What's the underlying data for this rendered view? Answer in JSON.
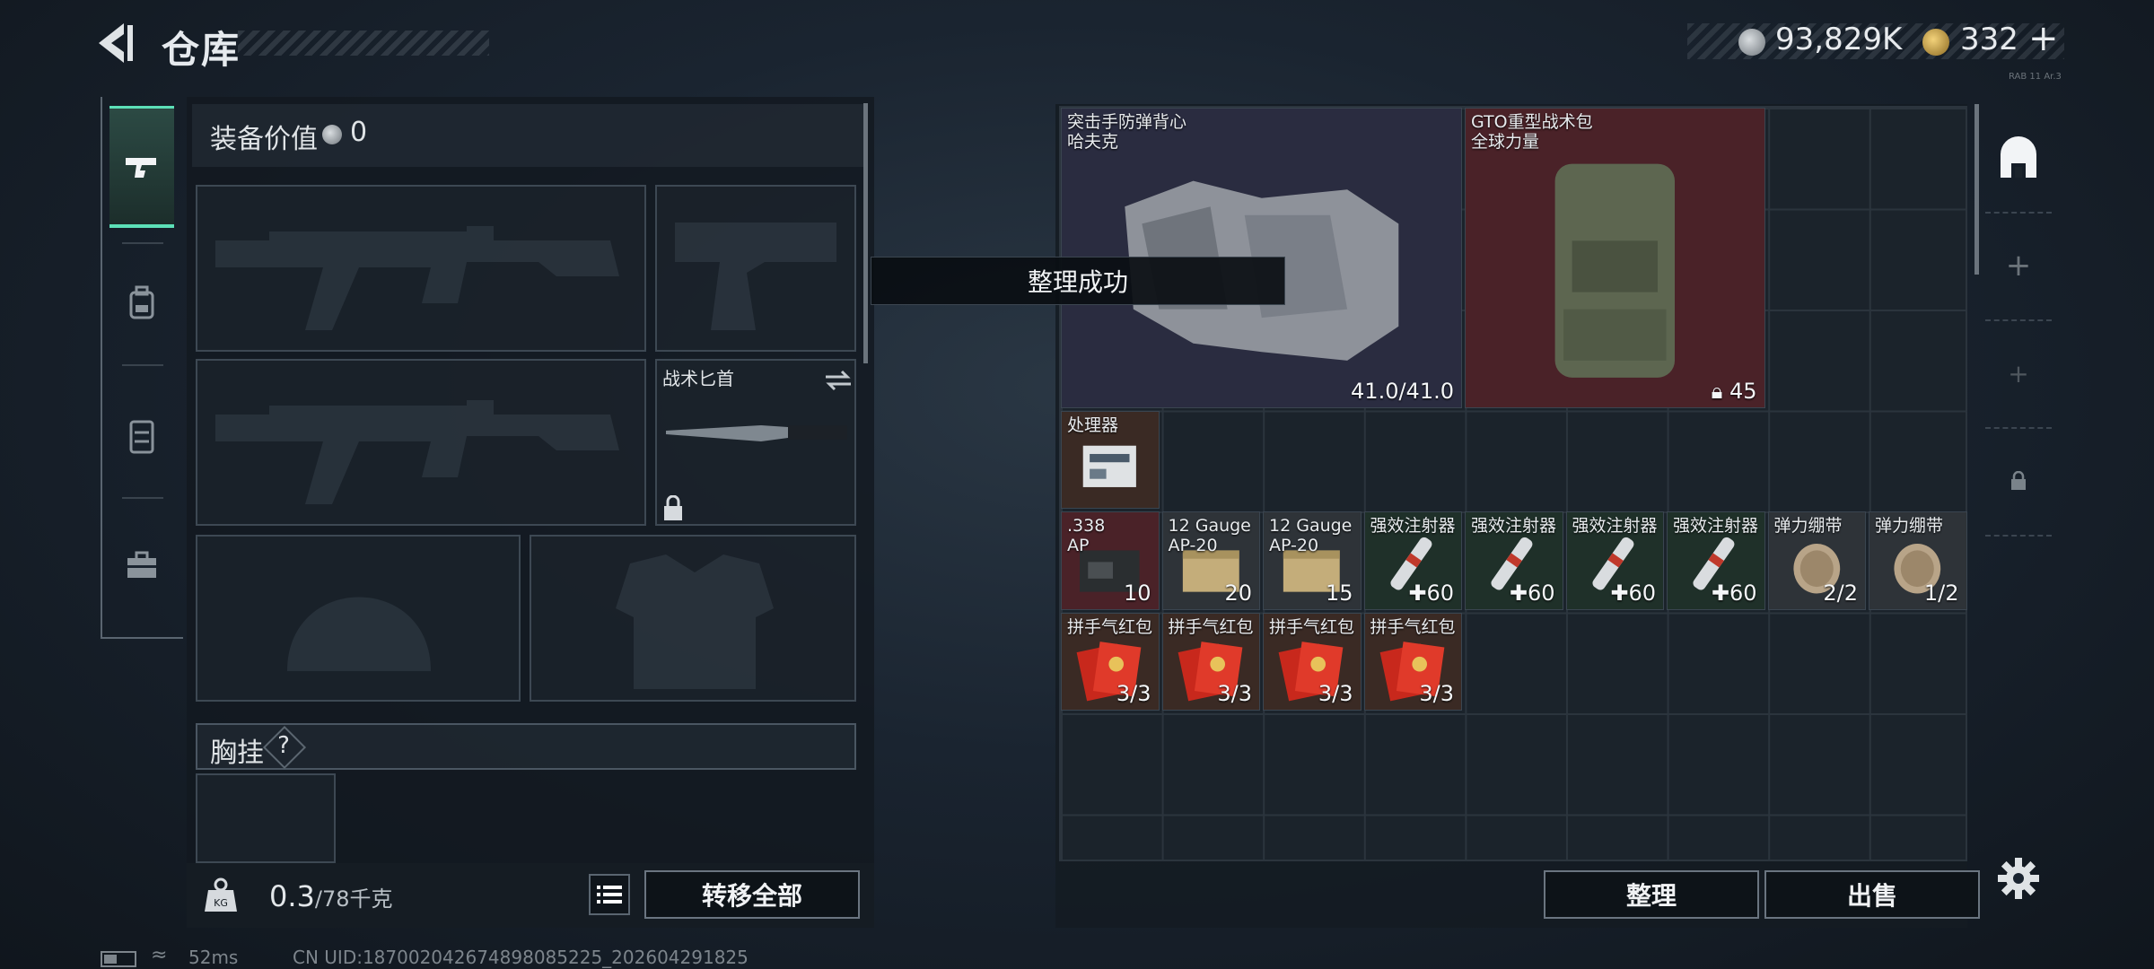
{
  "header": {
    "title": "仓库",
    "currency_silver": "93,829K",
    "currency_gold": "332",
    "add_label": "+",
    "tiny_tag": "RAB 11 Ar.3"
  },
  "sidebar": {
    "tabs": [
      {
        "icon": "pistol-icon",
        "active": true
      },
      {
        "icon": "backpack-icon",
        "active": false
      },
      {
        "icon": "vest-icon",
        "active": false
      },
      {
        "icon": "toolbox-icon",
        "active": false
      }
    ]
  },
  "equipment": {
    "value_label": "装备价值",
    "value": "0",
    "melee_label": "战术匕首",
    "chest_label": "胸挂",
    "chest_help": "?",
    "weight_value": "0.3",
    "weight_max": "/78千克",
    "transfer_all": "转移全部"
  },
  "toast": "整理成功",
  "inventory": {
    "items": [
      {
        "name": "突击手防弹背心\n哈夫克",
        "count": "41.0/41.0",
        "kind": "vest",
        "bg": "#2a2c40"
      },
      {
        "name": "GTO重型战术包\n全球力量",
        "count": "45",
        "kind": "backpack",
        "bg": "#4a2228"
      },
      {
        "name": "处理器",
        "count": "",
        "kind": "processor",
        "bg": "#3a2a24"
      },
      {
        "name": ".338\nAP",
        "count": "10",
        "kind": "ammo-box",
        "bg": "#4a2228"
      },
      {
        "name": "12 Gauge\nAP-20",
        "count": "20",
        "kind": "ammo-crate",
        "bg": "#2e3338"
      },
      {
        "name": "12 Gauge\nAP-20",
        "count": "15",
        "kind": "ammo-crate",
        "bg": "#2e3338"
      },
      {
        "name": "强效注射器",
        "count": "60",
        "kind": "injector",
        "bg": "#1f3029"
      },
      {
        "name": "强效注射器",
        "count": "60",
        "kind": "injector",
        "bg": "#1f3029"
      },
      {
        "name": "强效注射器",
        "count": "60",
        "kind": "injector",
        "bg": "#1f3029"
      },
      {
        "name": "强效注射器",
        "count": "60",
        "kind": "injector",
        "bg": "#1f3029"
      },
      {
        "name": "弹力绷带",
        "count": "2/2",
        "kind": "bandage",
        "bg": "#2e3338"
      },
      {
        "name": "弹力绷带",
        "count": "1/2",
        "kind": "bandage",
        "bg": "#2e3338"
      },
      {
        "name": "拼手气红包",
        "count": "3/3",
        "kind": "red-packet",
        "bg": "#3a2a24"
      },
      {
        "name": "拼手气红包",
        "count": "3/3",
        "kind": "red-packet",
        "bg": "#3a2a24"
      },
      {
        "name": "拼手气红包",
        "count": "3/3",
        "kind": "red-packet",
        "bg": "#3a2a24"
      },
      {
        "name": "拼手气红包",
        "count": "3/3",
        "kind": "red-packet",
        "bg": "#3a2a24"
      }
    ],
    "sort_button": "整理",
    "sell_button": "出售"
  },
  "status": {
    "ping": "52ms",
    "uid": "CN UID:18700204267489808​5225_202604291825"
  }
}
